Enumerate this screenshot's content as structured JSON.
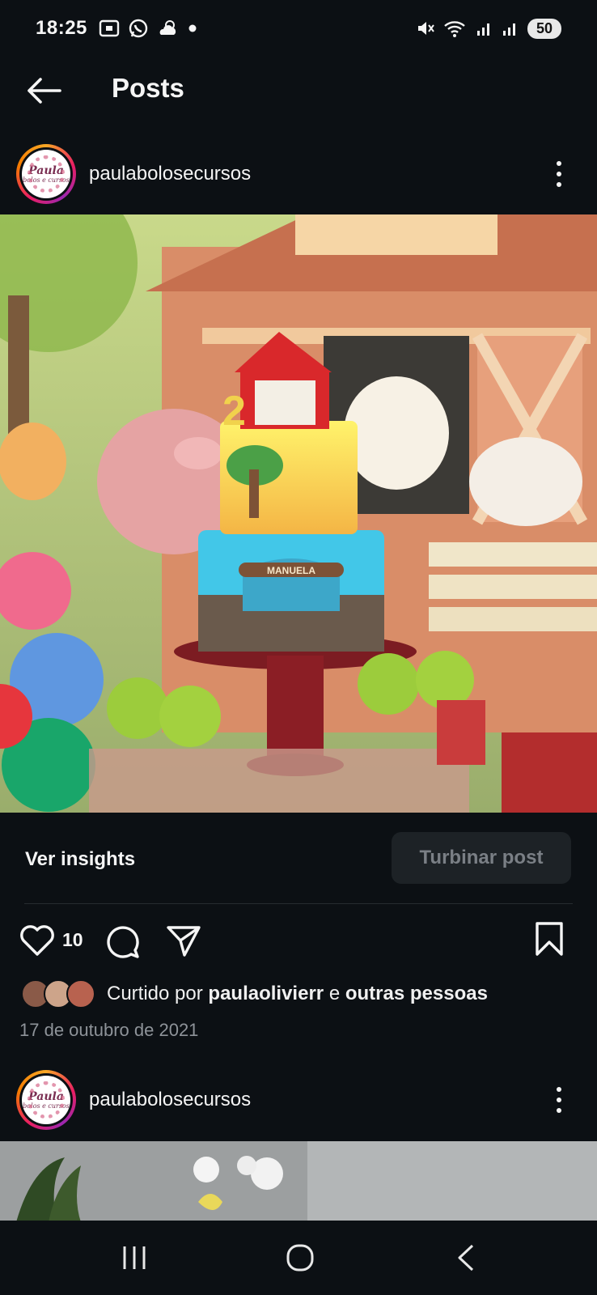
{
  "status_bar": {
    "time": "18:25",
    "battery": "50",
    "left_icons": [
      "screenshot-icon",
      "whatsapp-icon",
      "weather-icon",
      "notification-dot-icon"
    ],
    "right_icons": [
      "mute-icon",
      "wifi-icon",
      "signal-icon",
      "signal-icon"
    ]
  },
  "header": {
    "title": "Posts",
    "back_icon": "arrow-left-icon"
  },
  "posts": [
    {
      "username": "paulabolosecursos",
      "avatar_text_1": "Paula",
      "avatar_text_2": "bolos e cursos",
      "image_subject": "farm themed birthday cake",
      "cake_lettering": "2",
      "cake_name": "MANUELA",
      "insights_label": "Ver insights",
      "boost_label": "Turbinar post",
      "likes": "10",
      "liked_by_prefix": "Curtido por",
      "liked_by_user": "paulaolivierr",
      "liked_by_connector": "e",
      "liked_by_suffix": "outras pessoas",
      "date": "17 de outubro de 2021"
    },
    {
      "username": "paulabolosecursos",
      "avatar_text_1": "Paula",
      "avatar_text_2": "bolos e cursos"
    }
  ],
  "colors": {
    "background": "#0c1014",
    "text": "#f5f5f5",
    "muted": "#8e9399",
    "boost_bg": "#1d2226",
    "boost_text": "#7a7f85"
  },
  "navbar": {
    "icons": [
      "recents-icon",
      "home-icon",
      "back-icon"
    ]
  }
}
